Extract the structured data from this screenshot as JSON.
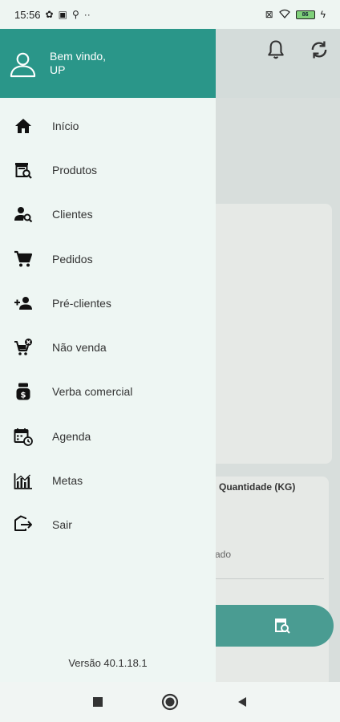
{
  "status": {
    "time": "15:56",
    "left_icons": [
      "gear-icon",
      "image-icon",
      "key-icon",
      "more-dots-icon"
    ],
    "right_icons": [
      "sim-icon",
      "wifi-icon",
      "battery-icon",
      "charging-icon"
    ],
    "battery_level": "86"
  },
  "drawer": {
    "welcome_line1": "Bem vindo,",
    "welcome_line2": "UP",
    "items": [
      {
        "label": "Início",
        "icon": "home-icon"
      },
      {
        "label": "Produtos",
        "icon": "product-search-icon"
      },
      {
        "label": "Clientes",
        "icon": "client-search-icon"
      },
      {
        "label": "Pedidos",
        "icon": "cart-icon"
      },
      {
        "label": "Pré-clientes",
        "icon": "add-person-icon"
      },
      {
        "label": "Não venda",
        "icon": "cart-cancel-icon"
      },
      {
        "label": "Verba comercial",
        "icon": "money-bag-icon"
      },
      {
        "label": "Agenda",
        "icon": "calendar-clock-icon"
      },
      {
        "label": "Metas",
        "icon": "bar-chart-icon"
      },
      {
        "label": "Sair",
        "icon": "logout-icon"
      }
    ],
    "version": "Versão 40.1.18.1"
  },
  "background": {
    "header_icons": [
      "bell-icon",
      "sync-icon"
    ],
    "quantity_label": "Quantidade (KG)",
    "partial_text": "ado",
    "fab_icon": "product-search-icon"
  },
  "colors": {
    "primary": "#2a9689",
    "drawer_bg": "#eef6f3",
    "fab": "#4a9c92"
  }
}
